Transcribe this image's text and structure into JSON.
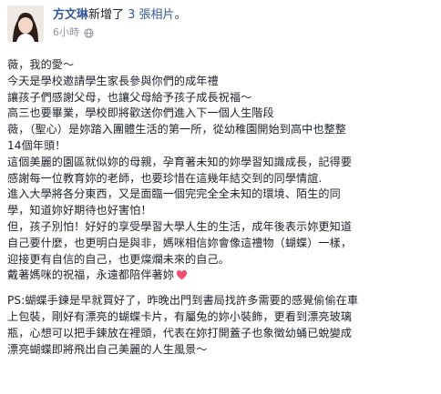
{
  "header": {
    "author": "方文琳",
    "action": "新增了 ",
    "photos_link": "3 張相片",
    "action_end": "。",
    "timestamp": "6小時",
    "privacy_icon": "globe-icon"
  },
  "body": {
    "lines": [
      "薇，我的愛～",
      "今天是學校邀請學生家長參與你們的成年禮",
      "讓孩子們感謝父母，也讓父母給予孩子成長祝福～",
      "高三也要畢業，學校即將歡送你們進入下一個人生階段",
      "薇，（聖心）是妳踏入團體生活的第一所，從幼稚園開始到高中也整整",
      "14個年頭！",
      "這個美麗的園區就似妳的母親，孕育著未知的妳學習知識成長，記得要",
      "感謝每一位教育妳的老師，也要珍惜在這幾年結交到的同學情誼.",
      "進入大學將各分東西，又是面臨一個完完全全未知的環境、陌生的同",
      "學，知道妳好期待也好害怕！",
      "但，孩子別怕！好好的享受學習大學人生的生活，成年後表示妳更知道",
      "自己要什麼，也更明白是與非，媽咪相信妳會像這禮物（蝴蝶）一樣，",
      "迎接更有自信的自己，也更燦爛未來的自己。",
      "戴著媽咪的祝福，永遠都陪伴著妳"
    ],
    "heart_icon": "heart-icon",
    "ps_lines": [
      "PS:蝴蝶手鍊是早就買好了，昨晚出門到書局找許多需要的感覺偷偷在車",
      "上包裝，剛好有漂亮的蝴蝶卡片，有屬兔的妳小裝飾，更看到漂亮玻璃",
      "瓶，心想可以把手鍊放在裡頭，代表在妳打開蓋子也象徵幼蛹已蛻變成",
      "漂亮蝴蝶即將飛出自己美麗的人生風景～"
    ]
  }
}
